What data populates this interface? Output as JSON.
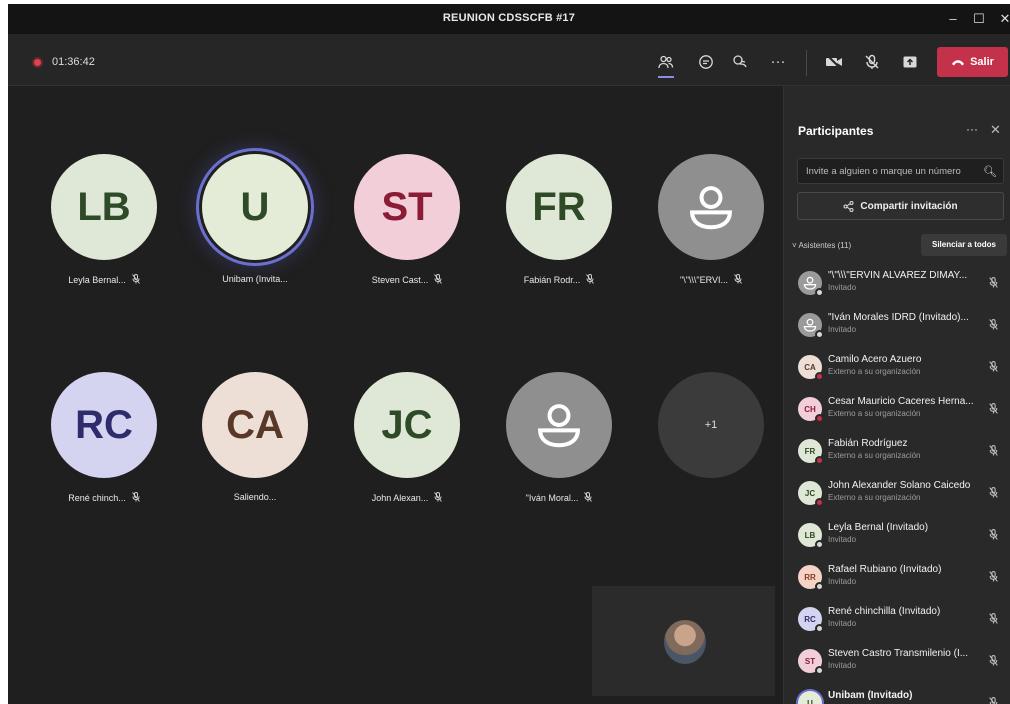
{
  "window": {
    "title": "REUNION CDSSCFB #17",
    "minimize": "–",
    "maximize": "☐",
    "close": "✕"
  },
  "toolbar": {
    "timer": "01:36:42",
    "leave_label": "Salir",
    "more": "···"
  },
  "tiles": [
    {
      "initials": "LB",
      "name": "Leyla Bernal...",
      "bg": "#dfe7d6",
      "fg": "#2e4a26",
      "muted": true
    },
    {
      "initials": "U",
      "name": "Unibam (Invita...",
      "bg": "#e4ecd8",
      "fg": "#2e4a26",
      "muted": false,
      "speaking": true
    },
    {
      "initials": "ST",
      "name": "Steven Cast...",
      "bg": "#f2cfd8",
      "fg": "#8a1c35",
      "muted": true
    },
    {
      "initials": "FR",
      "name": "Fabián Rodr...",
      "bg": "#dfe7d6",
      "fg": "#2e4a26",
      "muted": true
    },
    {
      "initials": "",
      "name": "\"\\\"\\\\\\\"ERVI...",
      "generic": true,
      "muted": true
    },
    {
      "initials": "RC",
      "name": "René chinch...",
      "bg": "#d4d3f0",
      "fg": "#2f2c6e",
      "muted": true
    },
    {
      "initials": "CA",
      "name": "Saliendo...",
      "bg": "#eedfd6",
      "fg": "#5a3828",
      "muted": false
    },
    {
      "initials": "JC",
      "name": "John Alexan...",
      "bg": "#dfe7d6",
      "fg": "#2e4a26",
      "muted": true
    },
    {
      "initials": "",
      "name": "\"Iván Moral...",
      "generic": true,
      "muted": true
    },
    {
      "initials": "+1",
      "name": "",
      "more": true,
      "muted": false
    }
  ],
  "panel": {
    "title": "Participantes",
    "more": "···",
    "close": "✕",
    "invite_placeholder": "Invite a alguien o marque un número",
    "share_label": "Compartir invitación",
    "attendees_label": "Asistentes (11)",
    "mute_all_label": "Silenciar a todos"
  },
  "participants": [
    {
      "initials": "",
      "name": "\"\\\"\\\\\\\"ERVIN ALVAREZ DIMAY...",
      "sub": "Invitado",
      "bg": "#9a9a9a",
      "fg": "#fff",
      "status": "#d8d8d8",
      "generic": true
    },
    {
      "initials": "",
      "name": "\"Iván Morales IDRD (Invitado)...",
      "sub": "Invitado",
      "bg": "#9a9a9a",
      "fg": "#fff",
      "status": "#d8d8d8",
      "generic": true
    },
    {
      "initials": "CA",
      "name": "Camilo Acero Azuero",
      "sub": "Externo a su organización",
      "bg": "#eedfd6",
      "fg": "#5a3828",
      "status": "#c4314b"
    },
    {
      "initials": "CH",
      "name": "Cesar Mauricio Caceres Herna...",
      "sub": "Externo a su organización",
      "bg": "#f2cfd8",
      "fg": "#8a1c35",
      "status": "#c4314b"
    },
    {
      "initials": "FR",
      "name": "Fabián Rodríguez",
      "sub": "Externo a su organización",
      "bg": "#dfe7d6",
      "fg": "#2e4a26",
      "status": "#c4314b"
    },
    {
      "initials": "JC",
      "name": "John Alexander Solano Caicedo",
      "sub": "Externo a su organización",
      "bg": "#dfe7d6",
      "fg": "#2e4a26",
      "status": "#c4314b"
    },
    {
      "initials": "LB",
      "name": "Leyla Bernal (Invitado)",
      "sub": "Invitado",
      "bg": "#dfe7d6",
      "fg": "#2e4a26",
      "status": "#d8d8d8"
    },
    {
      "initials": "RR",
      "name": "Rafael Rubiano (Invitado)",
      "sub": "Invitado",
      "bg": "#f5d3c6",
      "fg": "#8a3a1c",
      "status": "#d8d8d8"
    },
    {
      "initials": "RC",
      "name": "René chinchilla (Invitado)",
      "sub": "Invitado",
      "bg": "#d4d3f0",
      "fg": "#2f2c6e",
      "status": "#d8d8d8"
    },
    {
      "initials": "ST",
      "name": "Steven Castro Transmilenio (I...",
      "sub": "Invitado",
      "bg": "#f2cfd8",
      "fg": "#8a1c35",
      "status": "#d8d8d8"
    },
    {
      "initials": "U",
      "name": "Unibam (Invitado)",
      "sub": "",
      "bg": "#e4ecd8",
      "fg": "#2e4a26",
      "status": "#d8d8d8",
      "highlight": true
    }
  ]
}
